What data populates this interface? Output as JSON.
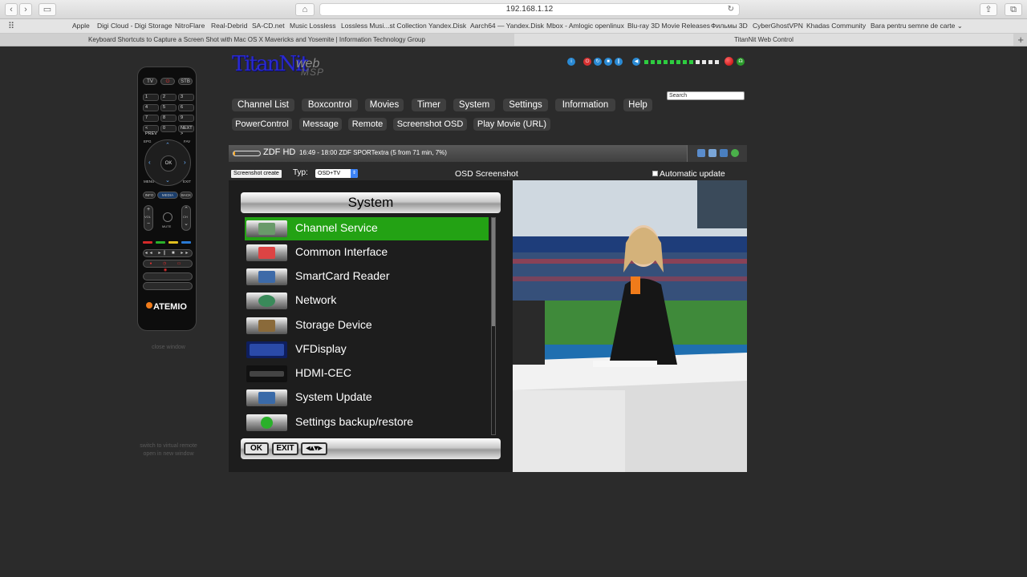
{
  "browser": {
    "url": "192.168.1.12",
    "bookmarks": [
      "Apple",
      "Digi Cloud - Digi Storage",
      "NitroFlare",
      "Real-Debrid",
      "SA-CD.net",
      "Music Lossless",
      "Lossless Musi...st Collection",
      "Yandex.Disk",
      "Aarch64 — Yandex.Disk",
      "Mbox - Amlogic openlinux",
      "Blu-ray 3D Movie Releases",
      "Фильмы 3D",
      "CyberGhostVPN",
      "Khadas Community",
      "Bara pentru semne de carte ⌄"
    ],
    "tabs": [
      {
        "title": "Keyboard Shortcuts to Capture a Screen Shot with Mac OS X Mavericks and Yosemite | Information Technology Group",
        "active": false
      },
      {
        "title": "TitanNit Web Control",
        "active": true
      }
    ]
  },
  "remote": {
    "tv_label": "TV",
    "stb_label": "STB",
    "numbers": [
      "1",
      "2",
      "3",
      "4",
      "5",
      "6",
      "7",
      "8",
      "9",
      "< PREV",
      "0",
      "NEXT >"
    ],
    "ok_label": "OK",
    "epg_label": "EPG",
    "fav_label": "FAV",
    "menu_label": "MENU",
    "exit_label": "EXIT",
    "info_label": "INFO",
    "media_label": "MEDIA",
    "back_label": "BACK",
    "mute_label": "MUTE",
    "vol_label": "VOL",
    "ch_label": "CH",
    "brand": "ATEMIO",
    "close_label": "close window",
    "switch_label_1": "switch to virtual remote",
    "switch_label_2": "open in new window"
  },
  "logo": {
    "main": "TitanNit",
    "sub1": "web",
    "sub2": "MSP"
  },
  "status": {
    "volume_level": 0.67
  },
  "search": {
    "placeholder": "Search"
  },
  "nav": {
    "row1": [
      "Channel List",
      "Boxcontrol",
      "Movies",
      "Timer",
      "System",
      "Settings",
      "Information",
      "Help"
    ],
    "row2": [
      "PowerControl",
      "Message",
      "Remote",
      "Screenshot OSD",
      "Play Movie (URL)"
    ]
  },
  "channel": {
    "name": "ZDF HD",
    "event": "16:49 - 18:00 ZDF SPORTextra (5 from 71 min, 7%)",
    "progress": 0.07
  },
  "screenshot": {
    "create_label": "Screenshot create",
    "typ_label": "Typ:",
    "typ_value": "OSD+TV",
    "title": "OSD Screenshot",
    "auto_update_label": "Automatic update"
  },
  "osd": {
    "title": "System",
    "items": [
      {
        "label": "Channel Service",
        "icon": "channel-service-icon",
        "selected": true
      },
      {
        "label": "Common Interface",
        "icon": "cam-icon"
      },
      {
        "label": "SmartCard Reader",
        "icon": "smartcard-icon"
      },
      {
        "label": "Network",
        "icon": "network-icon"
      },
      {
        "label": "Storage Device",
        "icon": "storage-icon"
      },
      {
        "label": "VFDisplay",
        "icon": "vfd-icon"
      },
      {
        "label": "HDMI-CEC",
        "icon": "hdmi-icon"
      },
      {
        "label": "System Update",
        "icon": "update-icon"
      },
      {
        "label": "Settings backup/restore",
        "icon": "backup-icon"
      }
    ],
    "footer": [
      "OK",
      "EXIT",
      "◂▴▾▸"
    ]
  },
  "colors": {
    "accent_green": "#23a214",
    "bg": "#2b2b2b",
    "nav_btn": "#3f3f3f"
  }
}
